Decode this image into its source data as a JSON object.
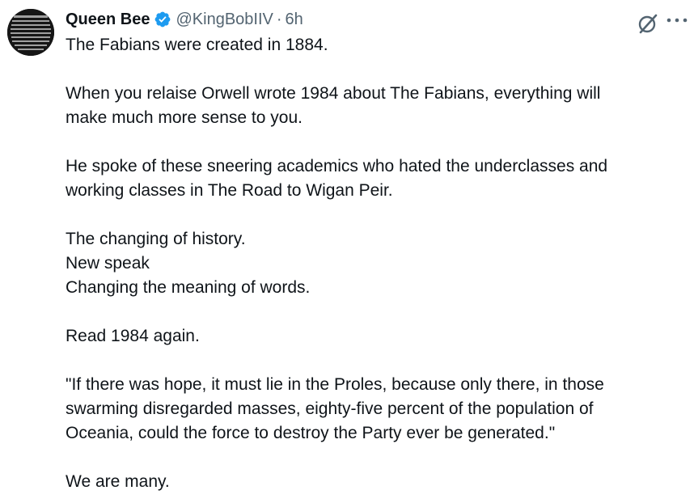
{
  "author": {
    "display_name": "Queen Bee",
    "handle": "@KingBobIIV",
    "separator": "·",
    "time": "6h",
    "verified": true,
    "verified_color": "#1d9bf0"
  },
  "icons": {
    "avatar": "avatar-image",
    "verified": "verified-badge-icon",
    "grok": "grok-icon",
    "more": "more-options-icon"
  },
  "tweet": {
    "paragraphs": [
      {
        "lines": [
          "The Fabians were created in 1884."
        ]
      },
      {
        "lines": [
          "When you relaise Orwell wrote 1984 about The Fabians, everything will",
          "make much more sense to you."
        ]
      },
      {
        "lines": [
          "He spoke of these sneering academics who hated the underclasses and",
          "working classes in The Road to Wigan Peir."
        ]
      },
      {
        "lines": [
          "The changing of history.",
          "New speak",
          "Changing the meaning of words."
        ]
      },
      {
        "lines": [
          "Read 1984 again."
        ]
      },
      {
        "lines": [
          "\"If there was hope, it must lie in the Proles, because only there, in those",
          "swarming disregarded masses, eighty-five percent of the population of",
          "Oceania, could the force to destroy the Party ever be generated.\""
        ]
      },
      {
        "lines": [
          "We are many."
        ]
      }
    ]
  }
}
